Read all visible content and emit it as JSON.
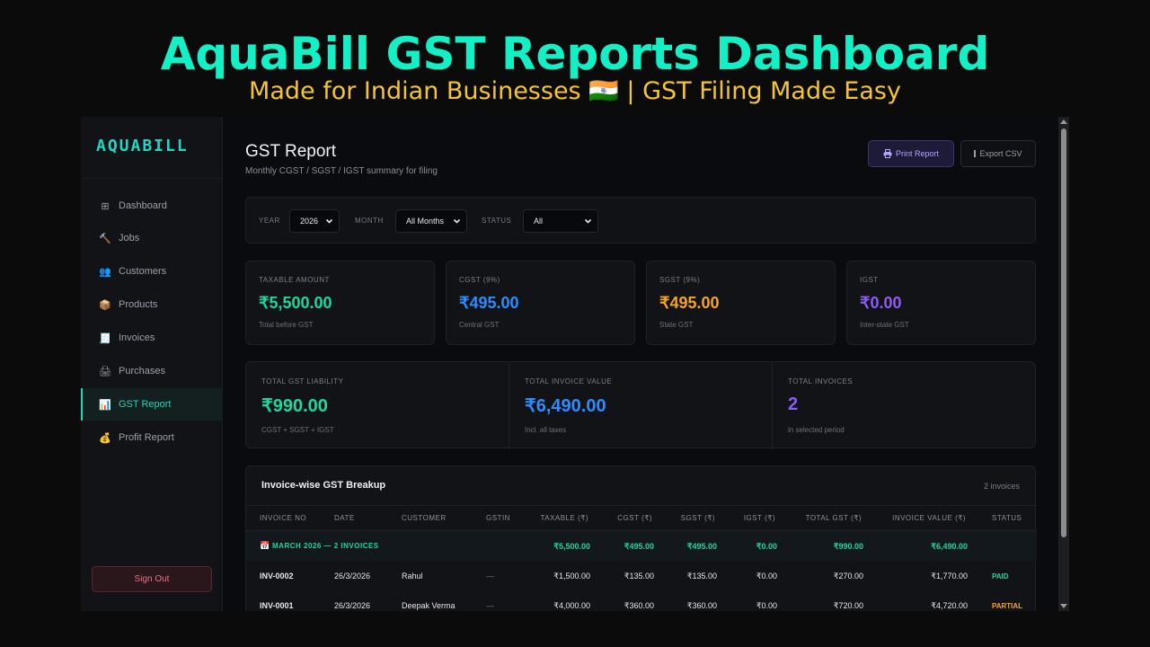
{
  "hero": {
    "title": "AquaBill GST Reports Dashboard",
    "subtitle": "Made for Indian Businesses 🇮🇳 | GST Filing Made Easy"
  },
  "sidebar": {
    "brand": "AQUABILL",
    "items": [
      {
        "label": "Dashboard",
        "icon": "⊞",
        "icon_name": "grid-icon",
        "active": false
      },
      {
        "label": "Jobs",
        "icon": "🔨",
        "icon_name": "hammer-icon",
        "active": false
      },
      {
        "label": "Customers",
        "icon": "👥",
        "icon_name": "users-icon",
        "active": false
      },
      {
        "label": "Products",
        "icon": "📦",
        "icon_name": "package-icon",
        "active": false
      },
      {
        "label": "Invoices",
        "icon": "🧾",
        "icon_name": "receipt-icon",
        "active": false
      },
      {
        "label": "Purchases",
        "icon": "🖨",
        "icon_name": "register-icon",
        "active": false
      },
      {
        "label": "GST Report",
        "icon": "📊",
        "icon_name": "bar-chart-icon",
        "active": true
      },
      {
        "label": "Profit Report",
        "icon": "💰",
        "icon_name": "money-bag-icon",
        "active": false
      }
    ],
    "signout": "Sign Out"
  },
  "header": {
    "title": "GST Report",
    "subtitle": "Monthly CGST / SGST / IGST summary for filing",
    "print_label": "Print Report",
    "export_label": "Export CSV"
  },
  "filters": {
    "year_label": "YEAR",
    "year_value": "2026",
    "month_label": "MONTH",
    "month_value": "All Months",
    "status_label": "STATUS",
    "status_value": "All"
  },
  "cards": [
    {
      "label": "TAXABLE AMOUNT",
      "value": "₹5,500.00",
      "note": "Total before GST",
      "color": "#1ed69f"
    },
    {
      "label": "CGST (9%)",
      "value": "₹495.00",
      "note": "Central GST",
      "color": "#2d8cff"
    },
    {
      "label": "SGST (9%)",
      "value": "₹495.00",
      "note": "State GST",
      "color": "#f5a524"
    },
    {
      "label": "IGST",
      "value": "₹0.00",
      "note": "Inter-state GST",
      "color": "#8b5cf6"
    }
  ],
  "summary": [
    {
      "label": "TOTAL GST LIABILITY",
      "value": "₹990.00",
      "note": "CGST + SGST + IGST",
      "color": "#1ed69f"
    },
    {
      "label": "TOTAL INVOICE VALUE",
      "value": "₹6,490.00",
      "note": "Incl. all taxes",
      "color": "#2d8cff"
    },
    {
      "label": "TOTAL INVOICES",
      "value": "2",
      "note": "in selected period",
      "color": "#8b5cf6"
    }
  ],
  "table": {
    "title": "Invoice-wise GST Breakup",
    "count": "2 invoices",
    "columns": [
      "INVOICE NO",
      "DATE",
      "CUSTOMER",
      "GSTIN",
      "TAXABLE (₹)",
      "CGST (₹)",
      "SGST (₹)",
      "IGST (₹)",
      "TOTAL GST (₹)",
      "INVOICE VALUE (₹)",
      "STATUS"
    ],
    "month_group": {
      "icon": "📅",
      "label": "MARCH 2026 — 2 INVOICES",
      "taxable": "₹5,500.00",
      "cgst": "₹495.00",
      "sgst": "₹495.00",
      "igst": "₹0.00",
      "total_gst": "₹990.00",
      "invoice_value": "₹6,490.00"
    },
    "rows": [
      {
        "invoice_no": "INV-0002",
        "date": "26/3/2026",
        "customer": "Rahul",
        "gstin": "—",
        "taxable": "₹1,500.00",
        "cgst": "₹135.00",
        "sgst": "₹135.00",
        "igst": "₹0.00",
        "total_gst": "₹270.00",
        "invoice_value": "₹1,770.00",
        "status": "PAID",
        "status_color": "#1ed69f"
      },
      {
        "invoice_no": "INV-0001",
        "date": "26/3/2026",
        "customer": "Deepak Verma",
        "gstin": "—",
        "taxable": "₹4,000.00",
        "cgst": "₹360.00",
        "sgst": "₹360.00",
        "igst": "₹0.00",
        "total_gst": "₹720.00",
        "invoice_value": "₹4,720.00",
        "status": "PARTIAL",
        "status_color": "#f5a524"
      }
    ]
  }
}
